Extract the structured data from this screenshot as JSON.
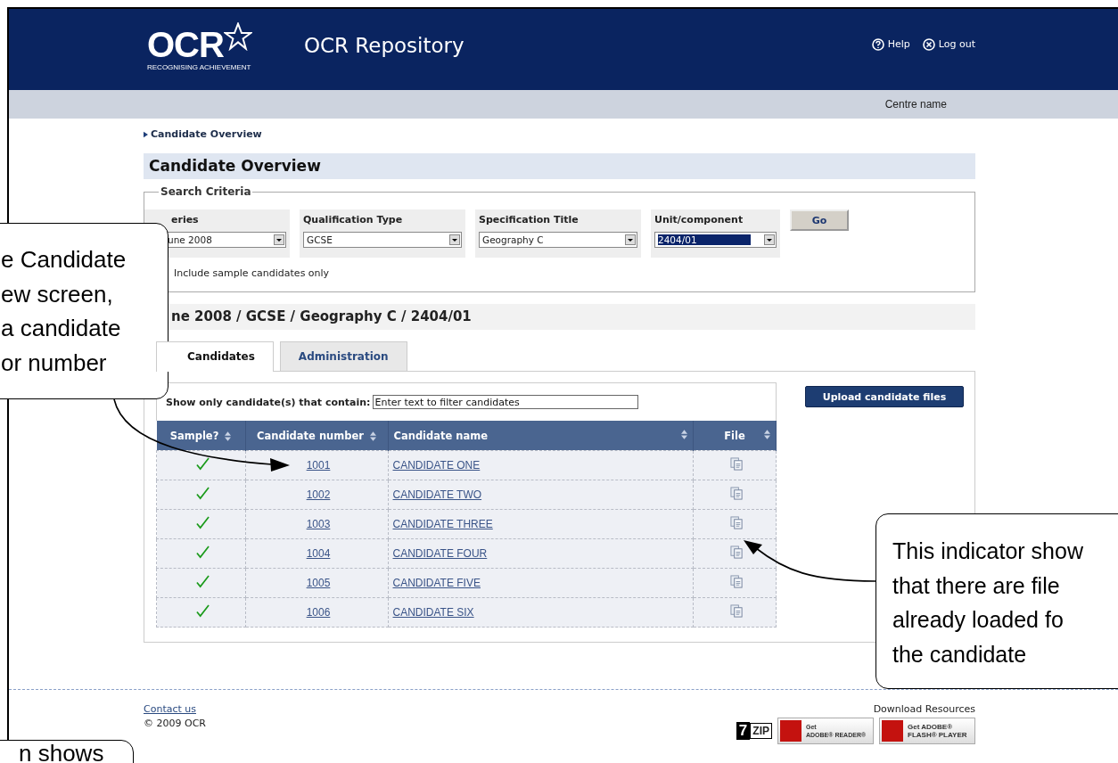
{
  "header": {
    "logo": {
      "wordmark": "OCR",
      "tagline": "RECOGNISING ACHIEVEMENT"
    },
    "title": "OCR Repository",
    "links": [
      {
        "kind": "help",
        "label": "Help"
      },
      {
        "kind": "logout",
        "label": "Log out"
      }
    ]
  },
  "centre_bar": {
    "label": "Centre name"
  },
  "breadcrumb": "Candidate Overview",
  "page_title": "Candidate Overview",
  "search_criteria": {
    "legend": "Search Criteria",
    "fields": [
      {
        "label": "eries",
        "value": "une 2008",
        "selected": false
      },
      {
        "label": "Qualification Type",
        "value": "GCSE",
        "selected": false
      },
      {
        "label": "Specification Title",
        "value": "Geography C",
        "selected": false
      },
      {
        "label": "Unit/component",
        "value": "2404/01",
        "selected": true
      }
    ],
    "go_button": "Go",
    "sample_only_label": "Include sample candidates only"
  },
  "selection_heading": "ne 2008 / GCSE / Geography C / 2404/01",
  "tabs": [
    {
      "label": "Candidates",
      "selected": true
    },
    {
      "label": "Administration",
      "selected": false
    }
  ],
  "filter": {
    "label": "Show only candidate(s) that contain:",
    "placeholder": "Enter text to filter candidates"
  },
  "upload_button": "Upload candidate files",
  "table": {
    "columns": [
      "Sample?",
      "Candidate number",
      "Candidate name",
      "File"
    ],
    "rows": [
      {
        "sample": true,
        "number": "1001",
        "name": "CANDIDATE ONE",
        "has_files": true
      },
      {
        "sample": true,
        "number": "1002",
        "name": "CANDIDATE TWO",
        "has_files": true
      },
      {
        "sample": true,
        "number": "1003",
        "name": "CANDIDATE THREE",
        "has_files": true
      },
      {
        "sample": true,
        "number": "1004",
        "name": "CANDIDATE FOUR",
        "has_files": true
      },
      {
        "sample": true,
        "number": "1005",
        "name": "CANDIDATE FIVE",
        "has_files": true
      },
      {
        "sample": true,
        "number": "1006",
        "name": "CANDIDATE SIX",
        "has_files": true
      }
    ]
  },
  "footer": {
    "contact": "Contact us",
    "copyright": "© 2009 OCR",
    "resources_label": "Download Resources",
    "badges": [
      {
        "kind": "zip",
        "lines": [
          "7",
          "ZIP"
        ]
      },
      {
        "kind": "reader",
        "lines": [
          "Get",
          "ADOBE® READER®"
        ]
      },
      {
        "kind": "flash",
        "lines": [
          "Get ADOBE®",
          "FLASH® PLAYER"
        ]
      }
    ]
  },
  "callouts": [
    {
      "kind": "left",
      "lines": [
        "e Candidate",
        "ew screen,",
        "a candidate",
        "or number"
      ]
    },
    {
      "kind": "right",
      "lines": [
        "This indicator show",
        "that there are file",
        "already loaded fo",
        "the candidate"
      ]
    },
    {
      "kind": "bottom",
      "lines": [
        "n shows"
      ]
    }
  ]
}
